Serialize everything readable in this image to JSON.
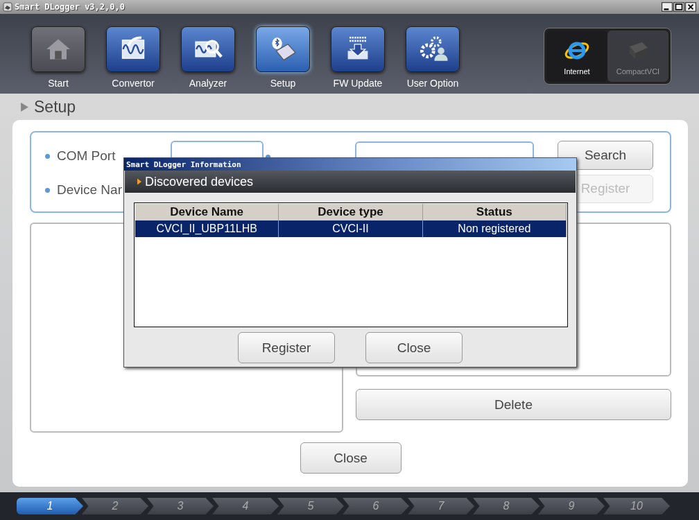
{
  "window": {
    "title": "Smart DLogger v3,2,0,0"
  },
  "toolbar": [
    {
      "label": "Start",
      "selected": false,
      "disabled": true
    },
    {
      "label": "Convertor",
      "selected": false,
      "disabled": false
    },
    {
      "label": "Analyzer",
      "selected": false,
      "disabled": false
    },
    {
      "label": "Setup",
      "selected": true,
      "disabled": false
    },
    {
      "label": "FW Update",
      "selected": false,
      "disabled": false
    },
    {
      "label": "User Option",
      "selected": false,
      "disabled": false
    }
  ],
  "quick_links": [
    {
      "label": "Internet",
      "disabled": false
    },
    {
      "label": "CompactVCI",
      "disabled": true
    }
  ],
  "section_title": "Setup",
  "form": {
    "com_port_label": "COM Port",
    "device_name_label": "Device Nar",
    "search_button": "Search",
    "register_button": {
      "label": "Register",
      "disabled": true
    }
  },
  "delete_button": "Delete",
  "close_button": "Close",
  "dialog": {
    "title": "Smart DLogger Information",
    "heading": "Discovered devices",
    "columns": [
      "Device Name",
      "Device type",
      "Status"
    ],
    "rows": [
      {
        "cells": [
          "CVCI_II_UBP11LHB",
          "CVCI-II",
          "Non registered"
        ],
        "selected": true
      }
    ],
    "buttons": [
      "Register",
      "Close"
    ]
  },
  "steps": [
    {
      "label": "1",
      "selected": true
    },
    {
      "label": "2",
      "selected": false
    },
    {
      "label": "3",
      "selected": false
    },
    {
      "label": "4",
      "selected": false
    },
    {
      "label": "5",
      "selected": false
    },
    {
      "label": "6",
      "selected": false
    },
    {
      "label": "7",
      "selected": false
    },
    {
      "label": "8",
      "selected": false
    },
    {
      "label": "9",
      "selected": false
    },
    {
      "label": "10",
      "selected": false
    }
  ]
}
